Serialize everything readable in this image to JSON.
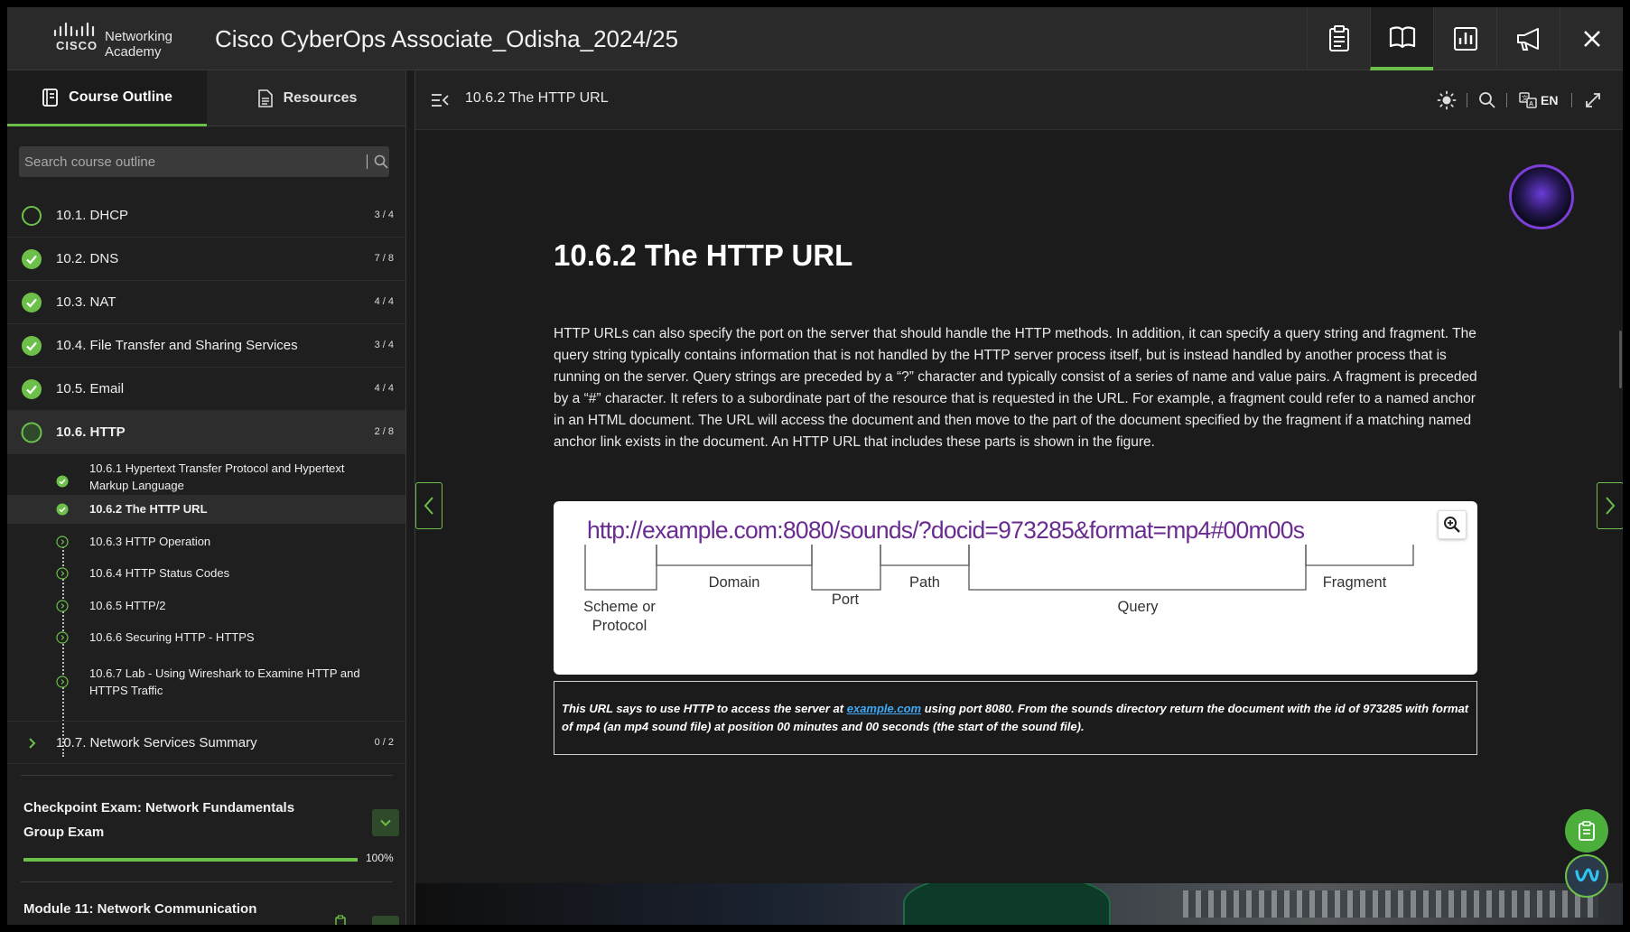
{
  "header": {
    "brand": "Networking Academy",
    "title": "Cisco CyberOps Associate_Odisha_2024/25",
    "buttons": [
      {
        "icon": "clipboard-icon",
        "active": false
      },
      {
        "icon": "book-icon",
        "active": true
      },
      {
        "icon": "chart-icon",
        "active": false
      },
      {
        "icon": "megaphone-icon",
        "active": false
      },
      {
        "icon": "close-icon",
        "active": false
      }
    ]
  },
  "sidebar": {
    "tabs": [
      {
        "label": "Course Outline",
        "active": true
      },
      {
        "label": "Resources",
        "active": false
      }
    ],
    "search": {
      "placeholder": "Search course outline"
    },
    "outline": [
      {
        "label": "10.1. DHCP",
        "count": "3 / 4",
        "status": "in-progress"
      },
      {
        "label": "10.2. DNS",
        "count": "7 / 8",
        "status": "complete"
      },
      {
        "label": "10.3. NAT",
        "count": "4 / 4",
        "status": "complete"
      },
      {
        "label": "10.4. File Transfer and Sharing Services",
        "count": "3 / 4",
        "status": "complete"
      },
      {
        "label": "10.5. Email",
        "count": "4 / 4",
        "status": "complete"
      },
      {
        "label": "10.6. HTTP",
        "count": "2 / 8",
        "status": "in-progress-filled"
      }
    ],
    "sub_items": [
      {
        "label": "10.6.1 Hypertext Transfer Protocol and Hypertext Markup Language",
        "status": "complete"
      },
      {
        "label": "10.6.2 The HTTP URL",
        "status": "complete"
      },
      {
        "label": "10.6.3 HTTP Operation",
        "status": "not-started"
      },
      {
        "label": "10.6.4 HTTP Status Codes",
        "status": "not-started"
      },
      {
        "label": "10.6.5 HTTP/2",
        "status": "not-started"
      },
      {
        "label": "10.6.6 Securing HTTP - HTTPS",
        "status": "not-started"
      },
      {
        "label": "10.6.7 Lab - Using Wireshark to Examine HTTP and HTTPS Traffic",
        "status": "not-started"
      }
    ],
    "summary": {
      "label": "10.7. Network Services Summary",
      "count": "0 / 2"
    },
    "checkpoint": {
      "title": "Checkpoint Exam: Network Fundamentals Group Exam",
      "progress": 1.0,
      "progress_label": "100%"
    },
    "next_module": {
      "title": "Module 11: Network Communication"
    }
  },
  "content": {
    "bar_title": "10.6.2 The HTTP URL",
    "language": "EN",
    "page_title": "10.6.2 The HTTP URL",
    "body": "HTTP URLs can also specify the port on the server that should handle the HTTP methods. In addition, it can specify a query string and fragment. The query string typically contains information that is not handled by the HTTP server process itself, but is instead handled by another process that is running on the server. Query strings are preceded by a “?” character and typically consist of a series of name and value pairs. A fragment is preceded by a “#” character. It refers to a subordinate part of the resource that is requested in the URL. For example, a fragment could refer to a named anchor in an HTML document. The URL will access the document and then move to the part of the document specified by the fragment if a matching named anchor link exists in the document. An HTTP URL that includes these parts is shown in the figure.",
    "figure": {
      "url": "http://example.com:8080/sounds/?docid=973285&format=mp4#00m00s",
      "labels": {
        "scheme_line1": "Scheme or",
        "scheme_line2": "Protocol",
        "domain": "Domain",
        "port": "Port",
        "path": "Path",
        "query": "Query",
        "fragment": "Fragment"
      }
    },
    "caption": {
      "before": "This URL says to use HTTP to access the server at ",
      "link": "example.com",
      "after": " using port 8080. From the sounds directory return the document with the id of 973285 with format of mp4 (an mp4 sound file) at position 00 minutes and 00 seconds (the start of the sound file)."
    }
  },
  "colors": {
    "accent_green": "#6cc04a",
    "url_purple": "#6a2c91",
    "link_blue": "#3fa9f5"
  }
}
